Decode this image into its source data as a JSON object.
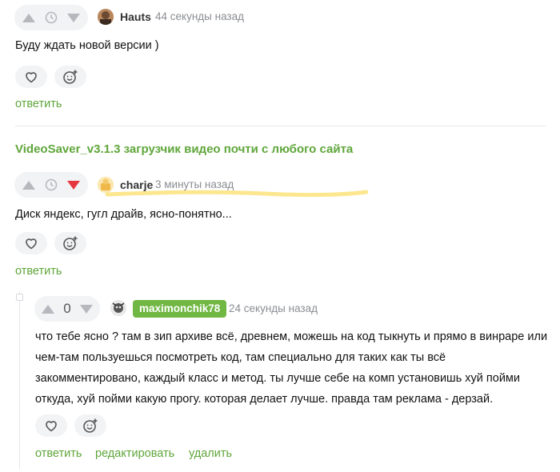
{
  "comments": [
    {
      "author": "Hauts",
      "time": "44 секунды назад",
      "text": "Буду ждать новой версии )",
      "reply_label": "ответить"
    },
    {
      "author": "charje",
      "time": "3 минуты назад",
      "text": "Диск яндекс, гугл драйв, ясно-понятно...",
      "reply_label": "ответить"
    },
    {
      "author": "maximonchik78",
      "time": "24 секунды назад",
      "score": "0",
      "text_lines": [
        "что тебе ясно ? там в зип архиве всё, древнем, можешь на код тыкнуть и прямо в винраре или",
        "чем-там пользуешься посмотреть код, там специально для таких как ты всё",
        "закомментировано, каждый класс и метод. ты лучше себе на комп установишь хуй пойми",
        "откуда, хуй пойми какую прогу. которая делает лучше. правда там реклама - дерзай."
      ],
      "reply_label": "ответить",
      "edit_label": "редактировать",
      "delete_label": "удалить"
    }
  ],
  "post_link": "VideoSaver_v3.1.3 загрузчик видео почти с любого сайта",
  "colors": {
    "accent_green": "#5fa63a",
    "badge_green": "#71b743",
    "downvote_red": "#e6363f",
    "highlight_yellow": "#fbe27a"
  }
}
